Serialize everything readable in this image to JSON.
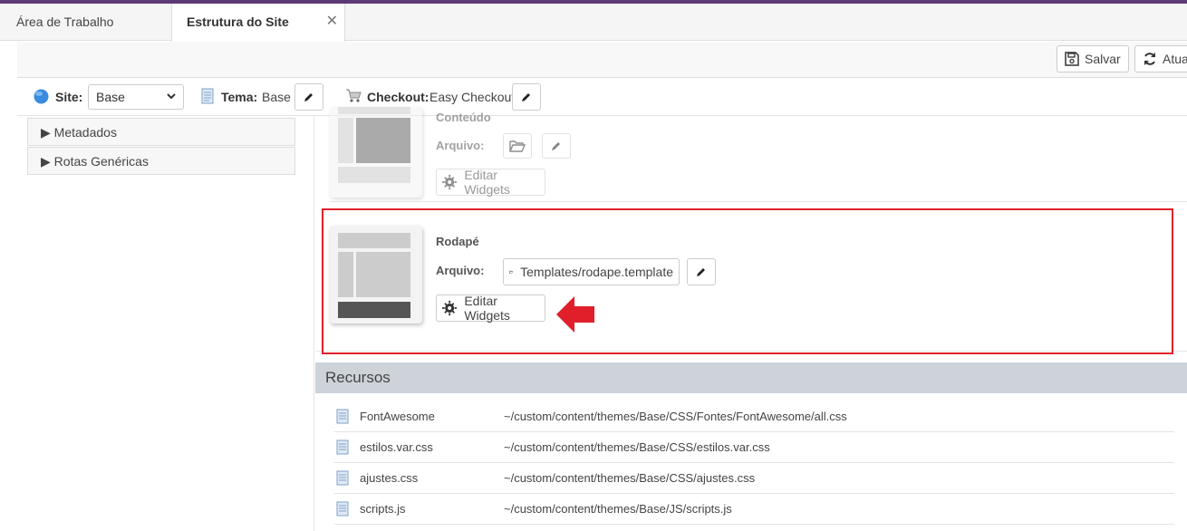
{
  "tabs": [
    {
      "label": "Área de Trabalho"
    },
    {
      "label": "Estrutura do Site"
    }
  ],
  "actions": {
    "save_label": "Salvar",
    "update_label": "Atua"
  },
  "sitebar": {
    "site_label": "Site:",
    "site_value": "Base",
    "tema_label": "Tema:",
    "tema_value": "Base",
    "checkout_label": "Checkout:",
    "checkout_value": "Easy Checkout"
  },
  "sidebar": {
    "items": [
      {
        "label": "Metadados"
      },
      {
        "label": "Rotas Genéricas"
      }
    ]
  },
  "sections": {
    "previous": {
      "title": "Conteúdo",
      "file_label": "Arquivo:",
      "file_value": "",
      "widgets_label": "Editar Widgets"
    },
    "footer": {
      "title": "Rodapé",
      "file_label": "Arquivo:",
      "file_value": "Templates/rodape.template",
      "widgets_label": "Editar Widgets"
    }
  },
  "recursos": {
    "title": "Recursos",
    "rows": [
      {
        "name": "FontAwesome",
        "path": "~/custom/content/themes/Base/CSS/Fontes/FontAwesome/all.css"
      },
      {
        "name": "estilos.var.css",
        "path": "~/custom/content/themes/Base/CSS/estilos.var.css"
      },
      {
        "name": "ajustes.css",
        "path": "~/custom/content/themes/Base/CSS/ajustes.css"
      },
      {
        "name": "scripts.js",
        "path": "~/custom/content/themes/Base/JS/scripts.js"
      }
    ]
  },
  "colors": {
    "accent_top": "#5c3a78",
    "highlight_border": "#e01f2b",
    "arrow": "#e01f2b",
    "section_header": "#cdd3d9"
  }
}
